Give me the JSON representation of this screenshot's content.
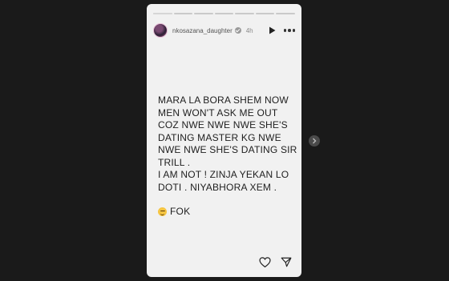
{
  "story": {
    "progress_segments": 7,
    "current_segment": 1,
    "current_progress": 1.0
  },
  "header": {
    "username": "nkosazana_daughter",
    "verified": true,
    "time": "4h"
  },
  "caption": {
    "lines": [
      "MARA LA BORA SHEM NOW",
      "MEN WON'T ASK ME OUT",
      "COZ NWE NWE NWE SHE'S",
      "DATING MASTER KG NWE",
      "NWE NWE SHE'S DATING SIR",
      "TRILL .",
      "I AM NOT ! ZINJA YEKAN LO",
      "DOTI . NIYABHORA XEM ."
    ],
    "emoji_text": "FOK",
    "emoji_icon": "smirk-face-icon"
  },
  "colors": {
    "page_bg": "#1a1a1a",
    "story_bg": "#f1f1f1",
    "text": "#1e1e1e"
  }
}
